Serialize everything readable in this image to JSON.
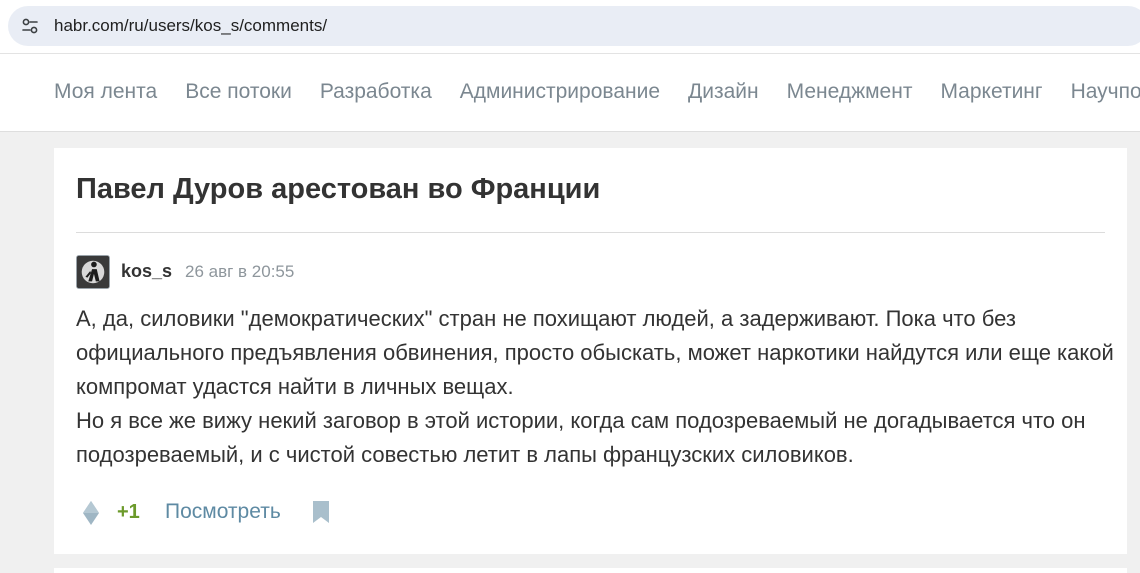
{
  "browser": {
    "url": "habr.com/ru/users/kos_s/comments/",
    "site_icon": "tune-icon"
  },
  "nav": {
    "items": [
      {
        "label": "Моя лента"
      },
      {
        "label": "Все потоки"
      },
      {
        "label": "Разработка"
      },
      {
        "label": "Администрирование"
      },
      {
        "label": "Дизайн"
      },
      {
        "label": "Менеджмент"
      },
      {
        "label": "Маркетинг"
      },
      {
        "label": "Научпоп"
      }
    ]
  },
  "comment": {
    "post_title": "Павел Дуров арестован во Франции",
    "author": "kos_s",
    "date": "26 авг в 20:55",
    "paragraphs": [
      "А, да, силовики \"демократических\" стран не похищают людей, а задерживают. Пока что без официального предъявления обвинения, просто обыскать, может наркотики найдутся или еще какой компромат удастся найти в личных вещах.",
      "Но я все же вижу некий заговор в этой истории, когда сам подозреваемый не догадывается что он подозреваемый, и с чистой совестью летит в лапы французских силовиков."
    ],
    "score": "+1",
    "view_label": "Посмотреть",
    "vote_icon": "vote-diamond-icon",
    "bookmark_icon": "bookmark-icon"
  },
  "colors": {
    "score_positive": "#6c9a2b",
    "link": "#5e8aa3",
    "nav_text": "#7b8790",
    "page_bg": "#f0f0f0"
  }
}
